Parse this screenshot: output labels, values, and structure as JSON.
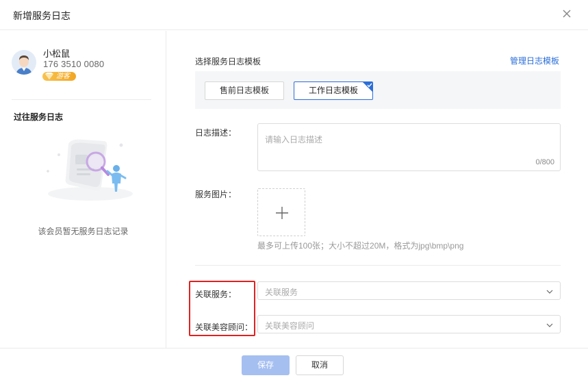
{
  "dialog": {
    "title": "新增服务日志"
  },
  "sidebar": {
    "user": {
      "name": "小松鼠",
      "phone": "176 3510 0080",
      "badge": "游客"
    },
    "history_title": "过往服务日志",
    "empty_text": "该会员暂无服务日志记录"
  },
  "form": {
    "template": {
      "label": "选择服务日志模板",
      "manage_link": "管理日志模板",
      "options": [
        {
          "label": "售前日志模板",
          "selected": false
        },
        {
          "label": "工作日志模板",
          "selected": true
        }
      ]
    },
    "description": {
      "label": "日志描述：",
      "placeholder": "请输入日志描述",
      "count": "0/800"
    },
    "images": {
      "label": "服务图片：",
      "hint": "最多可上传100张；大小不超过20M，格式为jpg\\bmp\\png"
    },
    "related_service": {
      "label": "关联服务：",
      "placeholder": "关联服务"
    },
    "related_consultant": {
      "label": "关联美容顾问：",
      "placeholder": "关联美容顾问"
    }
  },
  "footer": {
    "save_label": "保存",
    "cancel_label": "取消"
  },
  "colors": {
    "accent": "#2a6ed8",
    "save_disabled": "#a5bff0",
    "highlight": "#e02020",
    "badge": "#f2a623"
  }
}
